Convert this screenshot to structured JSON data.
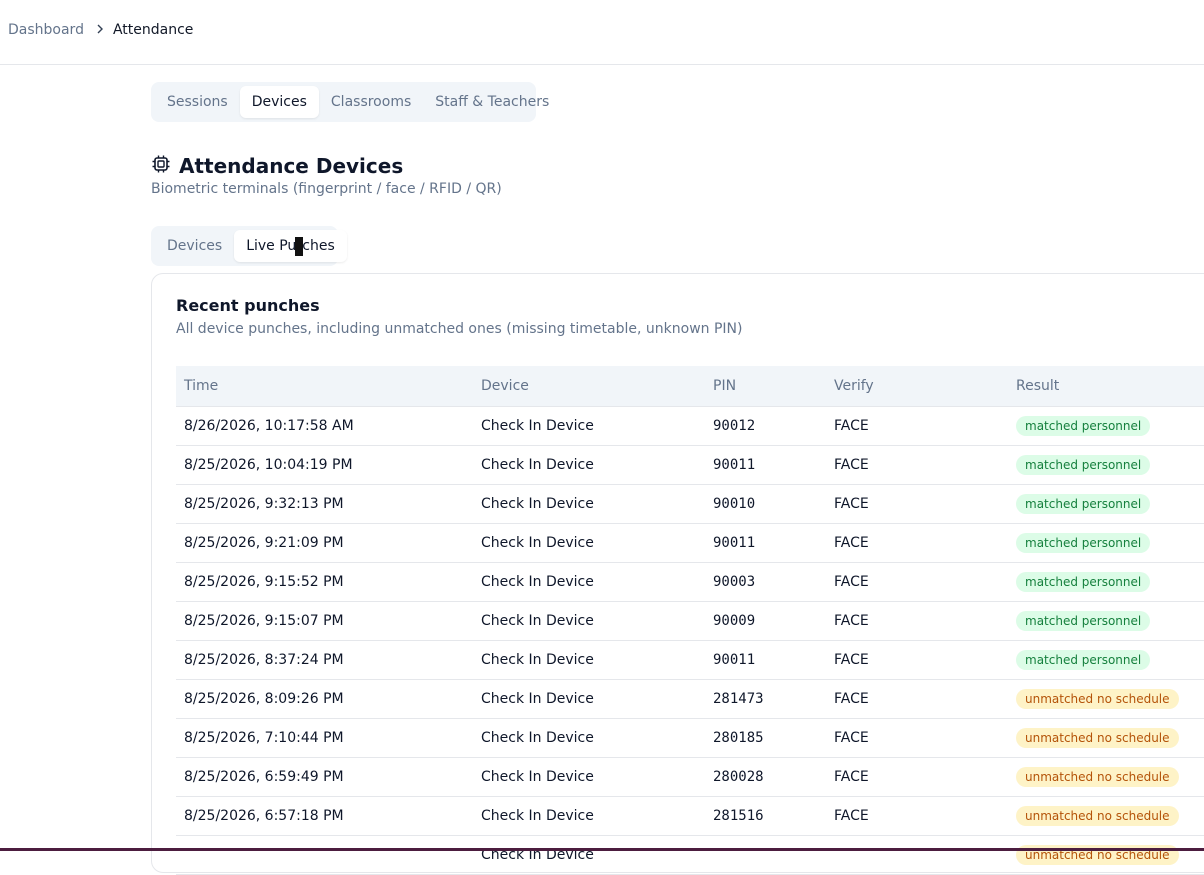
{
  "breadcrumb": {
    "parent": "Dashboard",
    "current": "Attendance"
  },
  "main_tabs": [
    {
      "label": "Sessions",
      "active": false
    },
    {
      "label": "Devices",
      "active": true
    },
    {
      "label": "Classrooms",
      "active": false
    },
    {
      "label": "Staff & Teachers",
      "active": false
    }
  ],
  "page": {
    "icon": "cpu-chip-icon",
    "title": "Attendance Devices",
    "subtitle": "Biometric terminals (fingerprint / face / RFID / QR)"
  },
  "sub_tabs": {
    "devices": "Devices",
    "live_punches_before": "Live Pu",
    "live_punches_after": "ches",
    "active": "Live Punches"
  },
  "card": {
    "title": "Recent punches",
    "description": "All device punches, including unmatched ones (missing timetable, unknown PIN)"
  },
  "table": {
    "headers": {
      "time": "Time",
      "device": "Device",
      "pin": "PIN",
      "verify": "Verify",
      "result": "Result"
    },
    "rows": [
      {
        "time": "8/26/2026, 10:17:58 AM",
        "device": "Check In Device",
        "pin": "90012",
        "verify": "FACE",
        "result": "matched personnel",
        "status": "ok"
      },
      {
        "time": "8/25/2026, 10:04:19 PM",
        "device": "Check In Device",
        "pin": "90011",
        "verify": "FACE",
        "result": "matched personnel",
        "status": "ok"
      },
      {
        "time": "8/25/2026, 9:32:13 PM",
        "device": "Check In Device",
        "pin": "90010",
        "verify": "FACE",
        "result": "matched personnel",
        "status": "ok"
      },
      {
        "time": "8/25/2026, 9:21:09 PM",
        "device": "Check In Device",
        "pin": "90011",
        "verify": "FACE",
        "result": "matched personnel",
        "status": "ok"
      },
      {
        "time": "8/25/2026, 9:15:52 PM",
        "device": "Check In Device",
        "pin": "90003",
        "verify": "FACE",
        "result": "matched personnel",
        "status": "ok"
      },
      {
        "time": "8/25/2026, 9:15:07 PM",
        "device": "Check In Device",
        "pin": "90009",
        "verify": "FACE",
        "result": "matched personnel",
        "status": "ok"
      },
      {
        "time": "8/25/2026, 8:37:24 PM",
        "device": "Check In Device",
        "pin": "90011",
        "verify": "FACE",
        "result": "matched personnel",
        "status": "ok"
      },
      {
        "time": "8/25/2026, 8:09:26 PM",
        "device": "Check In Device",
        "pin": "281473",
        "verify": "FACE",
        "result": "unmatched no schedule",
        "status": "warn"
      },
      {
        "time": "8/25/2026, 7:10:44 PM",
        "device": "Check In Device",
        "pin": "280185",
        "verify": "FACE",
        "result": "unmatched no schedule",
        "status": "warn"
      },
      {
        "time": "8/25/2026, 6:59:49 PM",
        "device": "Check In Device",
        "pin": "280028",
        "verify": "FACE",
        "result": "unmatched no schedule",
        "status": "warn"
      },
      {
        "time": "8/25/2026, 6:57:18 PM",
        "device": "Check In Device",
        "pin": "281516",
        "verify": "FACE",
        "result": "unmatched no schedule",
        "status": "warn"
      },
      {
        "time": "",
        "device": "Check In Device",
        "pin": "",
        "verify": "",
        "result": "unmatched no schedule",
        "status": "warn"
      }
    ]
  },
  "colors": {
    "matched_bg": "#dcfce7",
    "matched_text": "#15803d",
    "unmatched_bg": "#fef3c7",
    "unmatched_text": "#b45309"
  }
}
